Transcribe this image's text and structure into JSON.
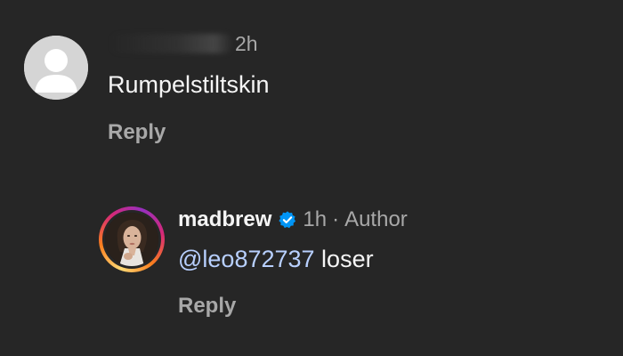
{
  "comments": [
    {
      "time": "2h",
      "text": "Rumpelstiltskin",
      "reply_label": "Reply"
    },
    {
      "username": "madbrew",
      "verified": true,
      "time": "1h",
      "separator": "·",
      "role": "Author",
      "mention": "@leo872737",
      "text": " loser",
      "reply_label": "Reply"
    }
  ],
  "colors": {
    "background": "#262626",
    "primary_text": "#f5f5f5",
    "secondary_text": "#a8a8a8",
    "mention": "#b8d0ff",
    "verified_badge": "#0095f6"
  },
  "icons": {
    "default_avatar": "default-avatar-icon",
    "verified": "verified-badge-icon"
  }
}
